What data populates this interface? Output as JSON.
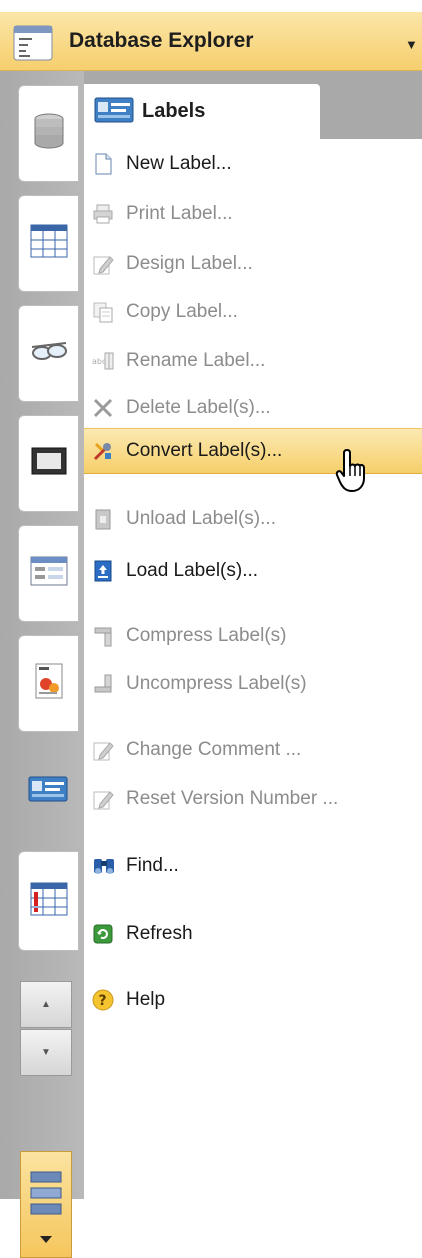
{
  "title_bar": {
    "title": "Database Explorer",
    "title_icon": "database-explorer-icon",
    "dropdown_icon": "chevron-down-icon"
  },
  "left_bar": {
    "tabs": [
      {
        "icon": "database-icon"
      },
      {
        "icon": "table-icon"
      },
      {
        "icon": "glasses-icon"
      },
      {
        "icon": "frame-icon"
      },
      {
        "icon": "form-icon"
      },
      {
        "icon": "report-icon"
      },
      {
        "icon": "labels-icon"
      },
      {
        "icon": "table-alert-icon"
      }
    ],
    "scroll_up_icon": "chevron-up-icon",
    "scroll_down_icon": "chevron-down-icon",
    "config_icon": "panel-config-icon"
  },
  "tab": {
    "label": "Labels",
    "icon": "labels-icon"
  },
  "menu": {
    "items": [
      {
        "label": "New Label...",
        "icon": "document-icon",
        "enabled": true
      },
      {
        "label": "Print Label...",
        "icon": "printer-icon",
        "enabled": false
      },
      {
        "label": "Design Label...",
        "icon": "pencil-icon",
        "enabled": false
      },
      {
        "label": "Copy Label...",
        "icon": "copy-icon",
        "enabled": false
      },
      {
        "label": "Rename Label...",
        "icon": "rename-icon",
        "enabled": false
      },
      {
        "label": "Delete Label(s)...",
        "icon": "delete-icon",
        "enabled": false
      },
      {
        "label": "Convert Label(s)...",
        "icon": "convert-tools-icon",
        "enabled": true,
        "highlighted": true
      },
      {
        "label": "Unload Label(s)...",
        "icon": "unload-icon",
        "enabled": false
      },
      {
        "label": "Load Label(s)...",
        "icon": "load-icon",
        "enabled": true
      },
      {
        "label": "Compress Label(s)",
        "icon": "compress-icon",
        "enabled": false
      },
      {
        "label": "Uncompress Label(s)",
        "icon": "uncompress-icon",
        "enabled": false
      },
      {
        "label": "Change Comment ...",
        "icon": "pencil-icon",
        "enabled": false
      },
      {
        "label": "Reset Version Number ...",
        "icon": "pencil-icon",
        "enabled": false
      },
      {
        "label": "Find...",
        "icon": "binoculars-icon",
        "enabled": true
      },
      {
        "label": "Refresh",
        "icon": "refresh-icon",
        "enabled": true
      },
      {
        "label": "Help",
        "icon": "help-icon",
        "enabled": true
      }
    ]
  },
  "cursor_icon": "hand-pointer-icon",
  "colors": {
    "highlight": "#f6cf6a",
    "titlebar": "#f6cf6e",
    "disabled_text": "#8c8c8c"
  }
}
